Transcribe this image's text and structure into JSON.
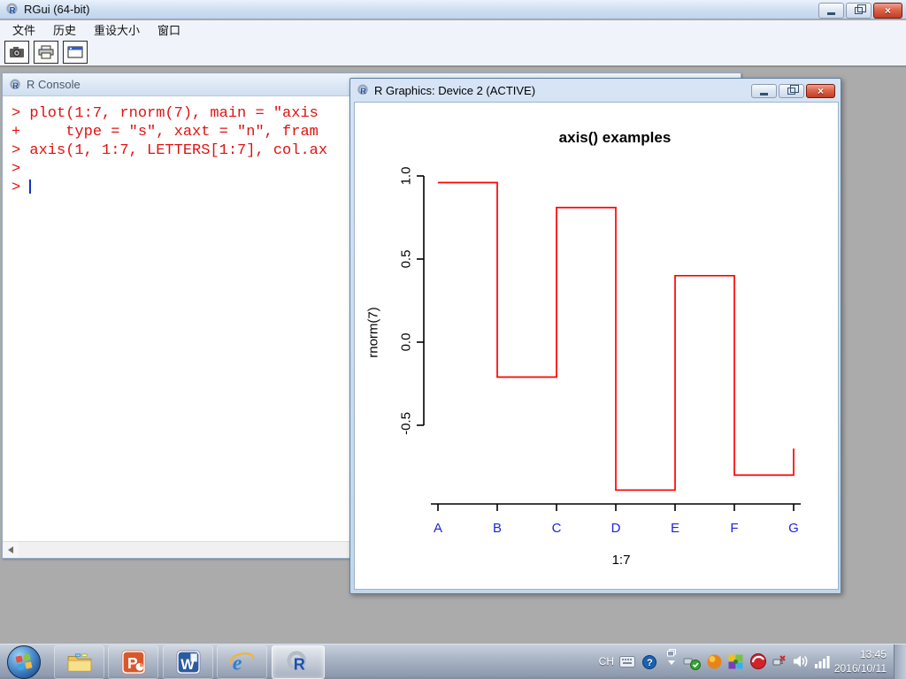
{
  "window": {
    "title": "RGui (64-bit)",
    "controls": {
      "minimize": "",
      "restore": "",
      "close": "×"
    }
  },
  "menubar": {
    "items": [
      "文件",
      "历史",
      "重设大小",
      "窗口"
    ]
  },
  "toolbar": {
    "buttons": [
      "snapshot",
      "print",
      "console-window"
    ]
  },
  "console": {
    "title": "R Console",
    "lines": [
      "> plot(1:7, rnorm(7), main = \"axis",
      "+     type = \"s\", xaxt = \"n\", fram",
      "> axis(1, 1:7, LETTERS[1:7], col.ax",
      ">",
      "> "
    ],
    "text_color": "#e01212",
    "cursor_color": "#1530cc"
  },
  "graphics": {
    "title": "R Graphics: Device 2 (ACTIVE)",
    "controls": {
      "close": "×"
    }
  },
  "chart_data": {
    "type": "line",
    "subtype": "step",
    "title": "axis() examples",
    "xlabel": "1:7",
    "ylabel": "rnorm(7)",
    "x": [
      1,
      2,
      3,
      4,
      5,
      6,
      7
    ],
    "values": [
      0.96,
      -0.21,
      0.81,
      -0.89,
      0.4,
      -0.8,
      -0.64
    ],
    "x_tick_labels": [
      "A",
      "B",
      "C",
      "D",
      "E",
      "F",
      "G"
    ],
    "y_tick_labels": [
      "1.0",
      "0.5",
      "0.0",
      "-0.5"
    ],
    "y_ticks": [
      1.0,
      0.5,
      0.0,
      -0.5
    ],
    "ylim": [
      -0.95,
      1.0
    ],
    "grid": false,
    "frame": false,
    "line_color": "#ff0000",
    "axis_color": "#000000",
    "x_tick_label_color": "#2222dd"
  },
  "taskbar": {
    "apps": [
      "windows-explorer",
      "powerpoint",
      "word",
      "internet-explorer",
      "r"
    ],
    "tray": {
      "language": "CH",
      "time": "13:45",
      "date": "2016/10/11"
    }
  }
}
